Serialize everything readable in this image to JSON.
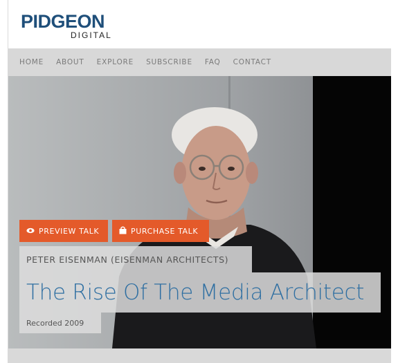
{
  "brand": {
    "name": "PIDGEON",
    "sub": "DIGITAL",
    "color": "#1f4f7a"
  },
  "nav": {
    "items": [
      {
        "label": "HOME"
      },
      {
        "label": "ABOUT"
      },
      {
        "label": "EXPLORE"
      },
      {
        "label": "SUBSCRIBE"
      },
      {
        "label": "FAQ"
      },
      {
        "label": "CONTACT"
      }
    ]
  },
  "hero": {
    "buttons": {
      "preview": {
        "label": "PREVIEW TALK",
        "icon": "eye-icon"
      },
      "purchase": {
        "label": "PURCHASE TALK",
        "icon": "shopping-bag-icon"
      }
    },
    "speaker": "PETER EISENMAN (EISENMAN ARCHITECTS)",
    "title": "The Rise Of The Media Architect",
    "recorded": "Recorded 2009",
    "accent_color": "#e45a2a",
    "title_color": "#2f6fa2"
  }
}
